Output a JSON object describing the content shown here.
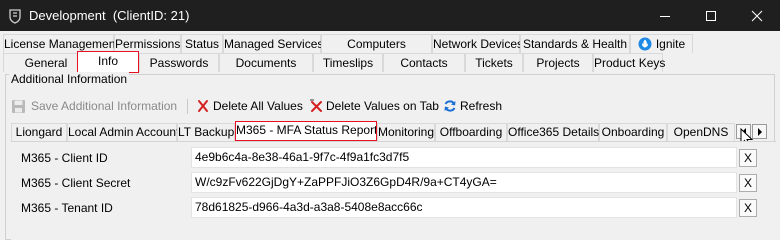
{
  "window": {
    "title": "Development",
    "client_id": "(ClientID: 21)"
  },
  "tabs_row1": [
    "License Management",
    "Permissions",
    "Status",
    "Managed Services",
    "Computers",
    "Network Devices",
    "Standards & Health",
    "Ignite"
  ],
  "tabs_row2": [
    "General",
    "Info",
    "Passwords",
    "Documents",
    "Timeslips",
    "Contacts",
    "Tickets",
    "Projects",
    "Product Keys"
  ],
  "selected_tab": "Info",
  "group_label": "Additional Information",
  "toolbar": {
    "save_label": "Save Additional Information",
    "delete_all_label": "Delete All Values",
    "delete_tab_label": "Delete Values on Tab",
    "refresh_label": "Refresh"
  },
  "subtabs": [
    "Liongard",
    "Local Admin Account",
    "LT Backup",
    "M365 - MFA Status Report",
    "Monitoring",
    "Offboarding",
    "Office365 Details",
    "Onboarding",
    "OpenDNS"
  ],
  "selected_subtab": "M365 - MFA Status Report",
  "fields": [
    {
      "label": "M365 - Client ID",
      "value": "4e9b6c4a-8e38-46a1-9f7c-4f9a1fc3d7f5",
      "clear": "X"
    },
    {
      "label": "M365 - Client Secret",
      "value": "W/c9zFv622GjDgY+ZaPPFJiO3Z6GpD4R/9a+CT4yGA=",
      "clear": "X"
    },
    {
      "label": "M365 - Tenant ID",
      "value": "78d61825-d966-4a3d-a3a8-5408e8acc66c",
      "clear": "X"
    }
  ],
  "colors": {
    "titlebar": "#1f1f1f",
    "highlight": "#e81123",
    "delete_icon": "#d42020",
    "refresh_icon": "#1a6fd6"
  }
}
